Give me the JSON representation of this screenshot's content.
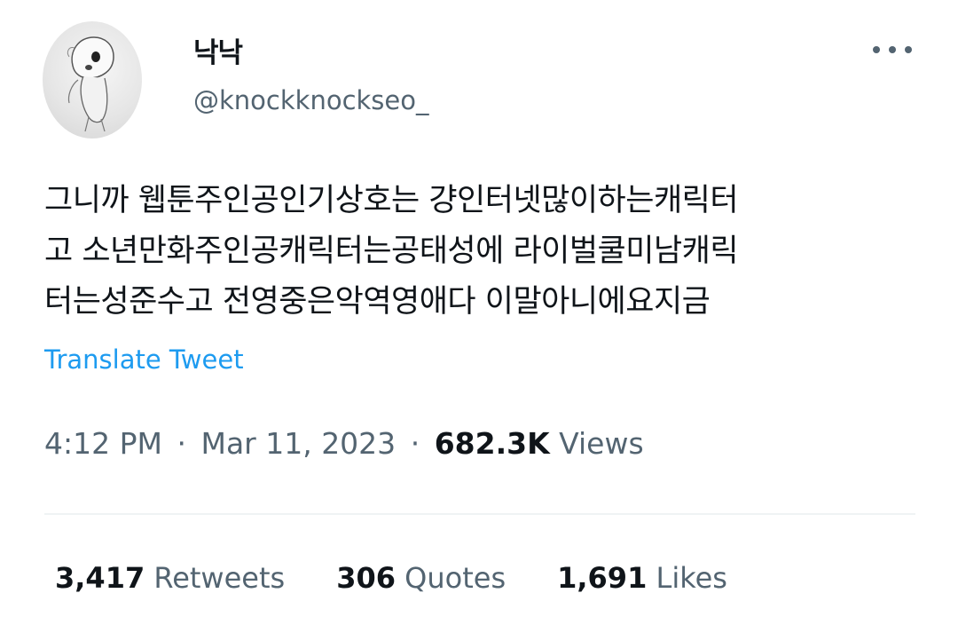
{
  "author": {
    "display_name": "낙낙",
    "handle": "@knockknockseo_",
    "avatar_icon": "character-sketch-avatar"
  },
  "more_icon": "more-dots-icon",
  "tweet": {
    "lines": [
      "그니까 웹툰주인공인기상호는 걍인터넷많이하는캐릭터",
      "고 소년만화주인공캐릭터는공태성에 라이벌쿨미남캐릭",
      "터는성준수고 전영중은악역영애다 이말아니에요지금"
    ],
    "translate_label": "Translate Tweet"
  },
  "meta": {
    "time": "4:12 PM",
    "separator": "·",
    "date": "Mar 11, 2023",
    "views_count": "682.3K",
    "views_label": "Views"
  },
  "stats": {
    "retweets_count": "3,417",
    "retweets_label": "Retweets",
    "quotes_count": "306",
    "quotes_label": "Quotes",
    "likes_count": "1,691",
    "likes_label": "Likes"
  },
  "colors": {
    "text_primary": "#0f1419",
    "text_secondary": "#536471",
    "link": "#1d9bf0",
    "divider": "#eff3f4"
  }
}
